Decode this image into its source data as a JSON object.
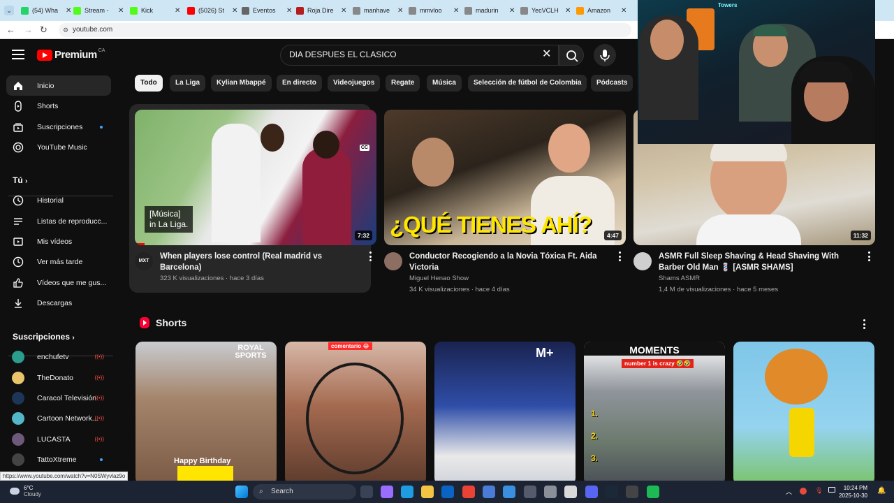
{
  "browser": {
    "tabs": [
      {
        "label": "(54) Wha",
        "color": "#25d366"
      },
      {
        "label": "Stream -",
        "color": "#53fc18"
      },
      {
        "label": "Kick",
        "color": "#53fc18"
      },
      {
        "label": "(5026) St",
        "color": "#ff0000"
      },
      {
        "label": "Eventos",
        "color": "#666666"
      },
      {
        "label": "Roja Dire",
        "color": "#b71c1c"
      },
      {
        "label": "manhave",
        "color": "#888888"
      },
      {
        "label": "mmvloo",
        "color": "#888888"
      },
      {
        "label": "madurin",
        "color": "#888888"
      },
      {
        "label": "YecVCLH",
        "color": "#888888"
      },
      {
        "label": "Amazon",
        "color": "#ff9900"
      }
    ],
    "url": "youtube.com",
    "status_url": "https://www.youtube.com/watch?v=N0SWyvlaz9o"
  },
  "youtube": {
    "brand": "Premium",
    "country": "CA",
    "search": {
      "value": "DIA DESPUES EL CLASICO"
    },
    "sidebar": {
      "main": [
        {
          "label": "Inicio",
          "icon": "home-icon",
          "active": true
        },
        {
          "label": "Shorts",
          "icon": "shorts-icon"
        },
        {
          "label": "Suscripciones",
          "icon": "subscriptions-icon",
          "dot": true
        },
        {
          "label": "YouTube Music",
          "icon": "music-icon"
        }
      ],
      "you_heading": "Tú",
      "you": [
        {
          "label": "Historial",
          "icon": "history-icon"
        },
        {
          "label": "Listas de reproducc...",
          "icon": "playlist-icon"
        },
        {
          "label": "Mis vídeos",
          "icon": "my-videos-icon"
        },
        {
          "label": "Ver más tarde",
          "icon": "watch-later-icon"
        },
        {
          "label": "Vídeos que me gus...",
          "icon": "like-icon"
        },
        {
          "label": "Descargas",
          "icon": "download-icon"
        }
      ],
      "subs_heading": "Suscripciones",
      "subscriptions": [
        {
          "label": "enchufetv",
          "color": "#2a9d8f",
          "live": true
        },
        {
          "label": "TheDonato",
          "color": "#e9c46a",
          "live": true
        },
        {
          "label": "Caracol Televisión",
          "color": "#1d3557",
          "live": true
        },
        {
          "label": "Cartoon Network...",
          "color": "#52b7c9",
          "live": true
        },
        {
          "label": "LUCASTA",
          "color": "#6d597a",
          "live": true
        },
        {
          "label": "TattoXtreme",
          "color": "#444444",
          "dot": true
        }
      ]
    },
    "chips": [
      "Todo",
      "La Liga",
      "Kylian Mbappé",
      "En directo",
      "Videojuegos",
      "Regate",
      "Música",
      "Selección de fútbol de Colombia",
      "Pódcasts"
    ],
    "videos": [
      {
        "title": "When players lose control (Real madrid vs Barcelona)",
        "channel": "mxt",
        "meta": "323 K visualizaciones · hace 3 días",
        "duration": "7:32",
        "caption": "[Música]\nin La Liga.",
        "cc": "CC",
        "avatar_text": "MXT"
      },
      {
        "title": "Conductor Recogiendo a la Novia Tóxica Ft. Aida Victoria",
        "channel": "Miguel Henao Show",
        "meta": "34 K visualizaciones · hace 4 días",
        "duration": "4:47",
        "overlay_text": "¿QUÉ TIENES AHÍ?"
      },
      {
        "title": "ASMR Full Sleep Shaving & Head Shaving With Barber Old Man 💈 [ASMR SHAMS]",
        "channel": "Shams ASMR",
        "meta": "1,4 M de visualizaciones · hace 5 meses",
        "duration": "11:32"
      }
    ],
    "shorts_heading": "Shorts",
    "shorts": [
      {
        "tag": "ROYAL SPORTS",
        "caption": "Happy Birthday"
      },
      {
        "tag": "comentario 😂"
      },
      {
        "tag": "M+"
      },
      {
        "tag": "MOMENTS",
        "caption": "number 1 is crazy 🤣🤣",
        "list": [
          "1.",
          "2.",
          "3."
        ]
      },
      {
        "tag": ""
      }
    ]
  },
  "taskbar": {
    "weather_temp": "6°C",
    "weather_desc": "Cloudy",
    "search_label": "Search",
    "time": "10:24 PM",
    "date": "2025-10-30"
  },
  "webcam": {
    "sign": "Towers"
  }
}
